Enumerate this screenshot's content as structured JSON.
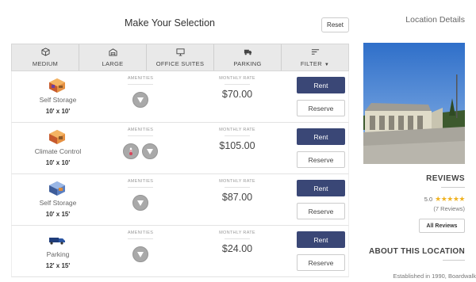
{
  "selection": {
    "title": "Make Your Selection",
    "reset_label": "Reset"
  },
  "tabs": [
    {
      "label": "MEDIUM",
      "icon": "box-icon"
    },
    {
      "label": "LARGE",
      "icon": "warehouse-icon"
    },
    {
      "label": "OFFICE SUITES",
      "icon": "monitor-icon"
    },
    {
      "label": "PARKING",
      "icon": "truck-icon"
    },
    {
      "label": "FILTER",
      "icon": "filter-icon"
    }
  ],
  "amenities_label": "AMENITIES",
  "rate_label": "MONTHLY RATE",
  "rent_label": "Rent",
  "reserve_label": "Reserve",
  "units": [
    {
      "type": "Self Storage",
      "size": "10' x 10'",
      "price": "$70.00",
      "amenities": [
        "ground-floor-icon"
      ]
    },
    {
      "type": "Climate Control",
      "size": "10' x 10'",
      "price": "$105.00",
      "amenities": [
        "thermometer-icon",
        "ground-floor-icon"
      ]
    },
    {
      "type": "Self Storage",
      "size": "10' x 15'",
      "price": "$87.00",
      "amenities": [
        "ground-floor-icon"
      ]
    },
    {
      "type": "Parking",
      "size": "12' x 15'",
      "price": "$24.00",
      "amenities": [
        "ground-floor-icon"
      ]
    }
  ],
  "location": {
    "title": "Location Details",
    "reviews_title": "REVIEWS",
    "rating": "5.0",
    "stars": "★★★★★",
    "review_count": "(7 Reviews)",
    "all_reviews_label": "All Reviews",
    "about_title": "ABOUT THIS LOCATION",
    "about_text": "Established in 1990, Boardwalk"
  },
  "colors": {
    "primary_button": "#3a4776",
    "star": "#f0b323",
    "tab_bar": "#e9e9e9"
  }
}
